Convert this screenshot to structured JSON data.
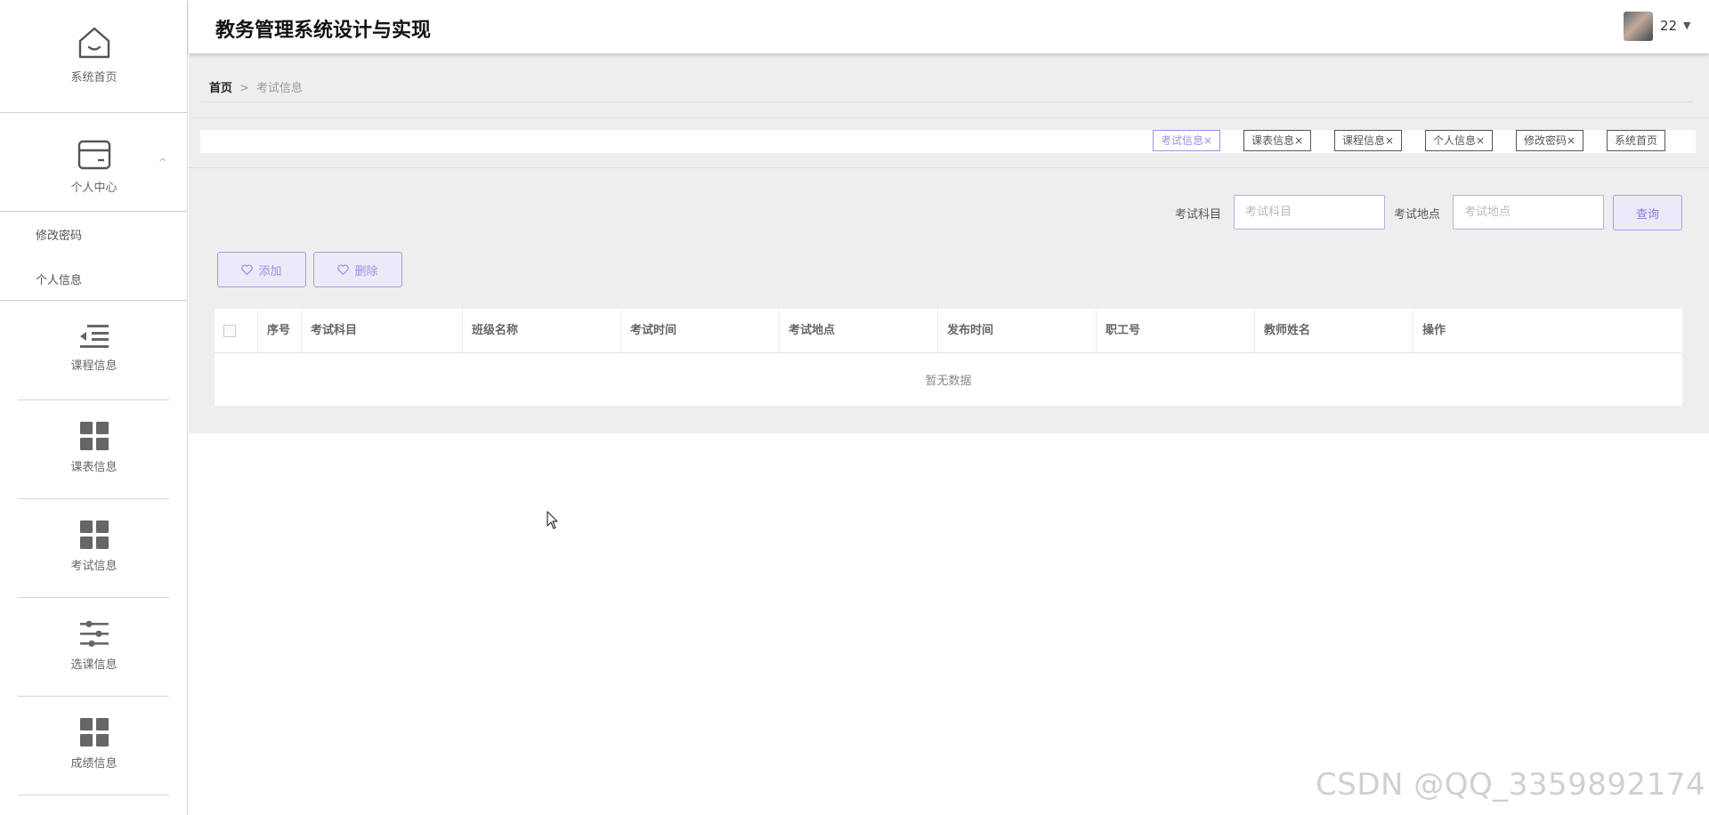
{
  "app": {
    "title": "教务管理系统设计与实现"
  },
  "user": {
    "name": "22",
    "caret": "▼"
  },
  "sidebar": {
    "home": {
      "label": "系统首页",
      "icon": "home-icon"
    },
    "personal": {
      "label": "个人中心",
      "icon": "card-icon",
      "chevron": "^",
      "sub_items": [
        "修改密码",
        "个人信息"
      ]
    },
    "items": [
      {
        "label": "课程信息",
        "icon": "list-indent-icon"
      },
      {
        "label": "课表信息",
        "icon": "grid-icon"
      },
      {
        "label": "考试信息",
        "icon": "grid-icon"
      },
      {
        "label": "选课信息",
        "icon": "sliders-icon"
      },
      {
        "label": "成绩信息",
        "icon": "grid-icon"
      }
    ]
  },
  "breadcrumb": {
    "home": "首页",
    "separator": ">",
    "current": "考试信息"
  },
  "tags": [
    {
      "label": "考试信息",
      "close": "×",
      "active": true
    },
    {
      "label": "课表信息",
      "close": "×",
      "active": false
    },
    {
      "label": "课程信息",
      "close": "×",
      "active": false
    },
    {
      "label": "个人信息",
      "close": "×",
      "active": false
    },
    {
      "label": "修改密码",
      "close": "×",
      "active": false
    },
    {
      "label": "系统首页",
      "close": "",
      "active": false
    }
  ],
  "search": {
    "subject_label": "考试科目",
    "subject_placeholder": "考试科目",
    "location_label": "考试地点",
    "location_placeholder": "考试地点",
    "query_button": "查询"
  },
  "actions": {
    "add": "添加",
    "delete": "删除"
  },
  "table": {
    "columns": [
      "序号",
      "考试科目",
      "班级名称",
      "考试时间",
      "考试地点",
      "发布时间",
      "职工号",
      "教师姓名",
      "操作"
    ],
    "empty_text": "暂无数据"
  },
  "watermark": "CSDN @QQ_3359892174",
  "colors": {
    "accent": "#9d8fe0",
    "accent_bg": "#ece9f8",
    "main_bg": "#eeeeee"
  }
}
